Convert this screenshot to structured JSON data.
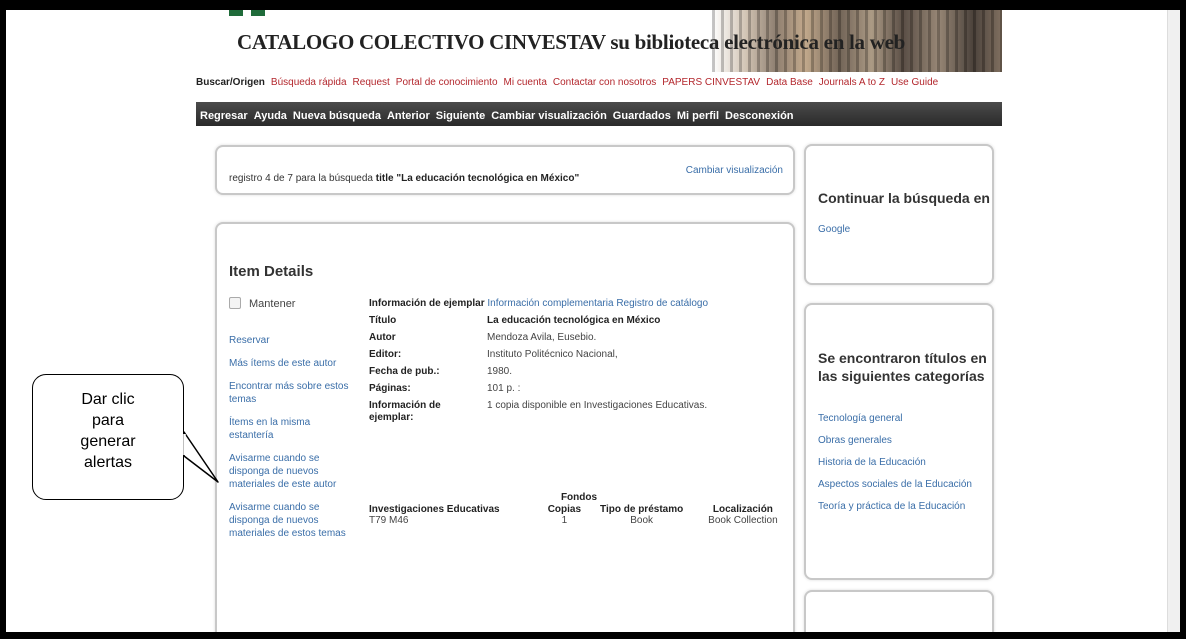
{
  "banner": {
    "title": "CATALOGO COLECTIVO CINVESTAV su biblioteca electrónica en la web"
  },
  "toplinks": {
    "first": "Buscar/Origen",
    "items": [
      "Búsqueda rápida",
      "Request",
      "Portal de conocimiento",
      "Mi cuenta",
      "Contactar con nosotros",
      "PAPERS CINVESTAV",
      "Data Base",
      "Journals A to Z",
      "Use Guide"
    ]
  },
  "navbar": {
    "items": [
      "Regresar",
      "Ayuda",
      "Nueva búsqueda",
      "Anterior",
      "Siguiente",
      "Cambiar visualización",
      "Guardados",
      "Mi perfil",
      "Desconexión"
    ]
  },
  "record": {
    "prefix": "registro 4 de 7 para la búsqueda",
    "query": "title \"La educación tecnológica en México\"",
    "change_view": "Cambiar visualización"
  },
  "details": {
    "heading": "Item Details",
    "keep_label": "Mantener",
    "actions": [
      "Reservar",
      "Más ítems de este autor",
      "Encontrar más sobre estos temas",
      "Ítems en la misma estantería",
      "Avisarme cuando se disponga de nuevos materiales de este autor",
      "Avisarme cuando se disponga de nuevos materiales de estos temas"
    ],
    "tabs": {
      "active": "Información de ejemplar",
      "link1": "Información complementaria",
      "link2": "Registro de catálogo"
    },
    "fields": [
      {
        "label": "Título",
        "value": "La educación tecnológica en México"
      },
      {
        "label": "Autor",
        "value": "Mendoza Avila, Eusebio."
      },
      {
        "label": "Editor:",
        "value": "Instituto Politécnico Nacional,"
      },
      {
        "label": "Fecha de pub.:",
        "value": "1980."
      },
      {
        "label": "Páginas:",
        "value": "101 p. :"
      },
      {
        "label": "Información de ejemplar:",
        "value": "1 copia disponible en Investigaciones Educativas."
      }
    ],
    "holdings": {
      "caption": "Fondos",
      "headers": [
        "Investigaciones Educativas",
        "Copias",
        "Tipo de préstamo",
        "Localización"
      ],
      "row": [
        "T79 M46",
        "1",
        "Book",
        "Book Collection"
      ]
    }
  },
  "sidebar": {
    "continue_title": "Continuar la búsqueda en",
    "continue_link": "Google",
    "cats_title": "Se encontraron títulos en las siguientes categorías",
    "categories": [
      "Tecnología general",
      "Obras generales",
      "Historia de la Educación",
      "Aspectos sociales de la Educación",
      "Teoría y práctica de la Educación"
    ]
  },
  "callout": {
    "lines": [
      "Dar clic",
      "para",
      "generar",
      "alertas"
    ]
  },
  "colors": {
    "link": "#3a6ea8",
    "toplink": "#b3272d",
    "navbar": "#333333"
  }
}
